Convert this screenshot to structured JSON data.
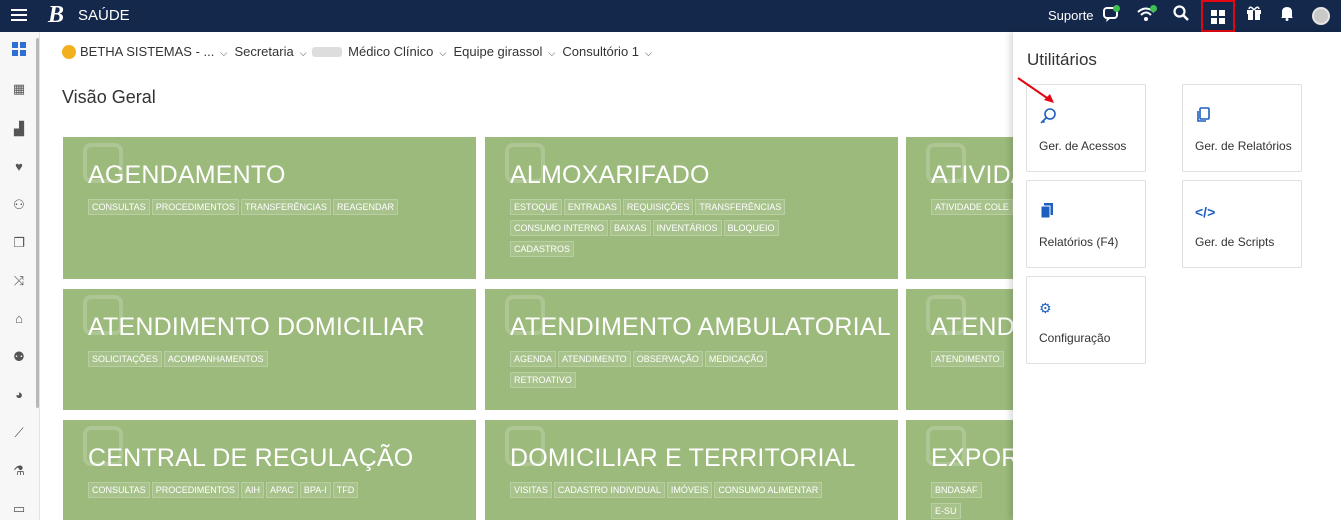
{
  "app": {
    "logo": "B",
    "title": "SAÚDE"
  },
  "topbar": {
    "support_label": "Suporte"
  },
  "context": {
    "organization": "BETHA SISTEMAS - ...",
    "items": [
      "Secretaria",
      "Médico Clínico",
      "Equipe girassol",
      "Consultório 1"
    ]
  },
  "page": {
    "title": "Visão Geral"
  },
  "cards": [
    {
      "title": "AGENDAMENTO",
      "tags": [
        "CONSULTAS",
        "PROCEDIMENTOS",
        "TRANSFERÊNCIAS",
        "REAGENDAR"
      ]
    },
    {
      "title": "ALMOXARIFADO",
      "tags": [
        "ESTOQUE",
        "ENTRADAS",
        "REQUISIÇÕES",
        "TRANSFERÊNCIAS",
        "CONSUMO INTERNO",
        "BAIXAS",
        "INVENTÁRIOS",
        "BLOQUEIO",
        "CADASTROS"
      ]
    },
    {
      "title": "ATIVIDA",
      "tags": [
        "ATIVIDADE COLE"
      ]
    },
    {
      "title": "ATENDIMENTO DOMICILIAR",
      "tags": [
        "SOLICITAÇÕES",
        "ACOMPANHAMENTOS"
      ]
    },
    {
      "title": "ATENDIMENTO AMBULATORIAL",
      "tags": [
        "AGENDA",
        "ATENDIMENTO",
        "OBSERVAÇÃO",
        "MEDICAÇÃO",
        "RETROATIVO"
      ]
    },
    {
      "title": "ATENDI",
      "tags": [
        "ATENDIMENTO"
      ]
    },
    {
      "title": "CENTRAL DE REGULAÇÃO",
      "tags": [
        "CONSULTAS",
        "PROCEDIMENTOS",
        "AIH",
        "APAC",
        "BPA-I",
        "TFD"
      ]
    },
    {
      "title": "DOMICILIAR E TERRITORIAL",
      "tags": [
        "VISITAS",
        "CADASTRO INDIVIDUAL",
        "IMÓVEIS",
        "CONSUMO ALIMENTAR"
      ]
    },
    {
      "title": "EXPORT",
      "tags": [
        "BNDASAF",
        "E-SU"
      ]
    }
  ],
  "utilities": {
    "title": "Utilitários",
    "tiles": [
      {
        "label": "Ger. de Acessos",
        "icon": "key-icon"
      },
      {
        "label": "Ger. de Relatórios",
        "icon": "copy-icon"
      },
      {
        "label": "Relatórios (F4)",
        "icon": "files-icon"
      },
      {
        "label": "Ger. de Scripts",
        "icon": "code-icon"
      },
      {
        "label": "Configuração",
        "icon": "gear-icon"
      }
    ]
  },
  "colors": {
    "topbar": "#14284b",
    "card": "#9cba7c",
    "accent": "#1f5fbf",
    "highlight": "#e30613"
  }
}
